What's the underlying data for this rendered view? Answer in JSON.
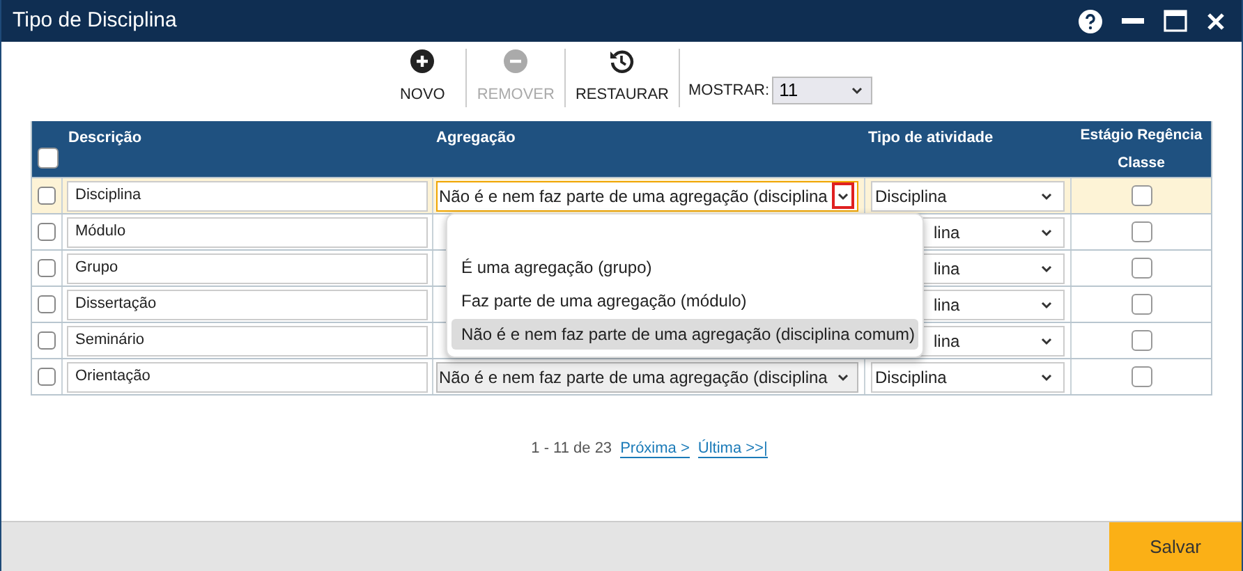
{
  "window": {
    "title": "Tipo de Disciplina"
  },
  "toolbar": {
    "buttons": [
      {
        "kind": "add",
        "label": "NOVO",
        "disabled": false
      },
      {
        "kind": "remove",
        "label": "REMOVER",
        "disabled": true
      },
      {
        "kind": "restore",
        "label": "RESTAURAR",
        "disabled": false
      }
    ],
    "show": {
      "label": "MOSTRAR:",
      "value": "11"
    }
  },
  "table": {
    "columns": [
      "Descrição",
      "Agregação",
      "Tipo de atividade",
      "Estágio Regência Classe"
    ],
    "all_checked": false,
    "rows": [
      {
        "checked": false,
        "selected": true,
        "description": "Disciplina",
        "aggregation": "Não é e nem faz parte de uma agregação (disciplina",
        "activity": "Disciplina",
        "activity_covered": false,
        "internship": false
      },
      {
        "checked": false,
        "selected": false,
        "description": "Módulo",
        "activity": "lina",
        "activity_covered": true,
        "internship": false
      },
      {
        "checked": false,
        "selected": false,
        "description": "Grupo",
        "activity": "lina",
        "activity_covered": true,
        "internship": false
      },
      {
        "checked": false,
        "selected": false,
        "description": "Dissertação",
        "activity": "lina",
        "activity_covered": true,
        "internship": false
      },
      {
        "checked": false,
        "selected": false,
        "description": "Seminário",
        "activity": "lina",
        "activity_covered": true,
        "internship": false
      },
      {
        "checked": false,
        "selected": false,
        "description": "Orientação",
        "aggregation": "Não é e nem faz parte de uma agregação (disciplina",
        "activity": "Disciplina",
        "activity_covered": false,
        "internship": false
      }
    ]
  },
  "dropdown": {
    "options": [
      {
        "label": "É uma agregação (grupo)",
        "selected": false
      },
      {
        "label": "Faz parte de uma agregação (módulo)",
        "selected": false
      },
      {
        "label": "Não é e nem faz parte de uma agregação (disciplina comum)",
        "selected": true
      }
    ]
  },
  "pagination": {
    "range": "1 - 11 de 23",
    "links": [
      "Próxima >",
      "Última >>|"
    ]
  },
  "footer": {
    "save": "Salvar"
  }
}
